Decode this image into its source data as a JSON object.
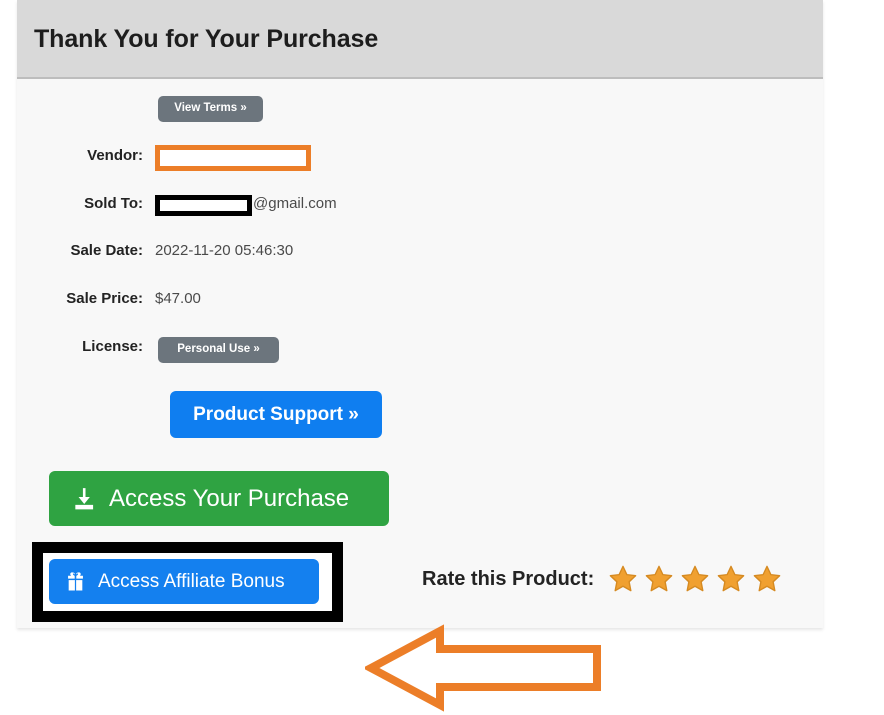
{
  "page": {
    "title": "Thank You for Your Purchase"
  },
  "terms": {
    "view_terms_label": "View Terms »"
  },
  "details": {
    "vendor": {
      "label": "Vendor:",
      "value": "",
      "redacted": true,
      "redaction_color": "#ec7e28"
    },
    "sold_to": {
      "label": "Sold To:",
      "value": "",
      "domain_suffix": "@gmail.com",
      "redacted": true,
      "redaction_color": "#000000"
    },
    "sale_date": {
      "label": "Sale Date:",
      "value": "2022-11-20 05:46:30"
    },
    "sale_price": {
      "label": "Sale Price:",
      "value": "$47.00"
    },
    "license": {
      "label": "License:",
      "value": "Personal Use »"
    }
  },
  "actions": {
    "product_support": "Product Support »",
    "access_purchase": "Access Your Purchase",
    "access_affiliate_bonus": "Access Affiliate Bonus"
  },
  "rating": {
    "label": "Rate this Product:",
    "max_stars": 5,
    "filled_stars": 5,
    "star_color": "#f0a030"
  },
  "icons": {
    "download": "download-icon",
    "gift": "gift-icon",
    "star": "star-icon",
    "arrow": "left-arrow-callout-icon"
  },
  "colors": {
    "header_bg": "#d9d9d9",
    "panel_bg": "#f8f8f8",
    "primary_blue": "#0f7ef0",
    "success_green": "#2fa342",
    "secondary_gray": "#6c757d",
    "accent_orange": "#ec7e28",
    "highlight_black": "#000000"
  },
  "annotations": {
    "highlight_target": "access-affiliate-bonus-button",
    "arrow_direction": "left"
  }
}
